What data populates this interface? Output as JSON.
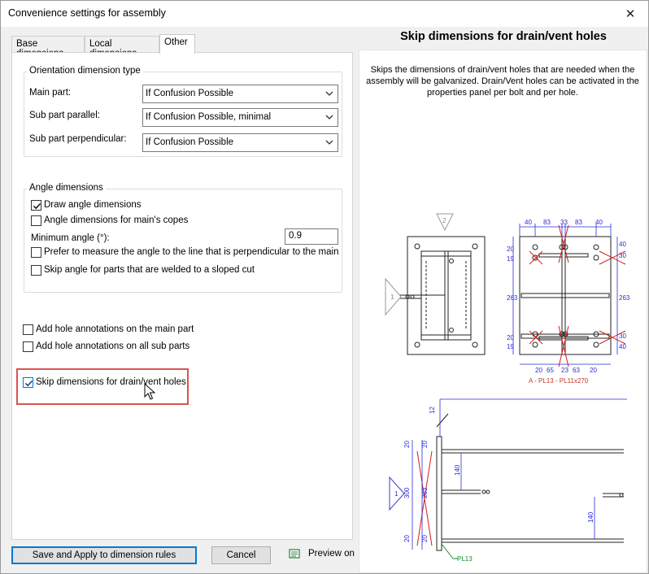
{
  "window": {
    "title": "Convenience settings for assembly",
    "close_glyph": "✕"
  },
  "tabs": [
    {
      "label": "Base dimensions",
      "active": false
    },
    {
      "label": "Local dimensions",
      "active": false
    },
    {
      "label": "Other",
      "active": true
    }
  ],
  "orientation": {
    "group_label": "Orientation dimension type",
    "main_part_label": "Main part:",
    "main_part_value": "If Confusion Possible",
    "sub_parallel_label": "Sub part parallel:",
    "sub_parallel_value": "If Confusion Possible, minimal",
    "sub_perp_label": "Sub part perpendicular:",
    "sub_perp_value": "If Confusion Possible"
  },
  "angle": {
    "group_label": "Angle dimensions",
    "draw_label": "Draw angle dimensions",
    "draw_checked": true,
    "copes_label": "Angle dimensions for main's copes",
    "copes_checked": false,
    "min_angle_label": "Minimum angle (°):",
    "min_angle_value": "0.9",
    "prefer_label": "Prefer to measure the angle to the line that is perpendicular to the main",
    "prefer_checked": false,
    "skip_sloped_label": "Skip angle for parts that are welded to a sloped cut",
    "skip_sloped_checked": false
  },
  "holes": {
    "main_label": "Add hole annotations on the main part",
    "main_checked": false,
    "sub_label": "Add hole annotations on all sub parts",
    "sub_checked": false,
    "skip_label": "Skip dimensions for drain/vent holes",
    "skip_checked": true
  },
  "buttons": {
    "save_apply": "Save and Apply to dimension rules",
    "cancel": "Cancel",
    "preview": "Preview on"
  },
  "info": {
    "title": "Skip dimensions for drain/vent holes",
    "description": "Skips the dimensions of drain/vent holes that are needed when the assembly will be galvanized. Drain/Vent holes can be activated in the properties panel per bolt and per hole."
  },
  "drawing": {
    "top_dims": [
      "40",
      "83",
      "33",
      "83",
      "40"
    ],
    "bottom_dims": [
      "20",
      "65",
      "23",
      "63",
      "20"
    ],
    "left_dims": [
      "19",
      "20",
      "263",
      "20",
      "19"
    ],
    "right_dims": [
      "40",
      "30",
      "263",
      "30",
      "40"
    ],
    "part_label": "A - PL13 - PL11x270",
    "view_markers": [
      "1",
      "2",
      "1"
    ],
    "side_dims": [
      "12",
      "20",
      "300",
      "20",
      "263",
      "20",
      "20",
      "140",
      "140"
    ],
    "weld_label": "PL13",
    "colors": {
      "dim": "#2a2ad8",
      "red": "#d21e1e",
      "part_label": "#c0392b",
      "weld_label": "#168a2e",
      "highlight": "#d9534f",
      "accent": "#0078d7"
    }
  }
}
